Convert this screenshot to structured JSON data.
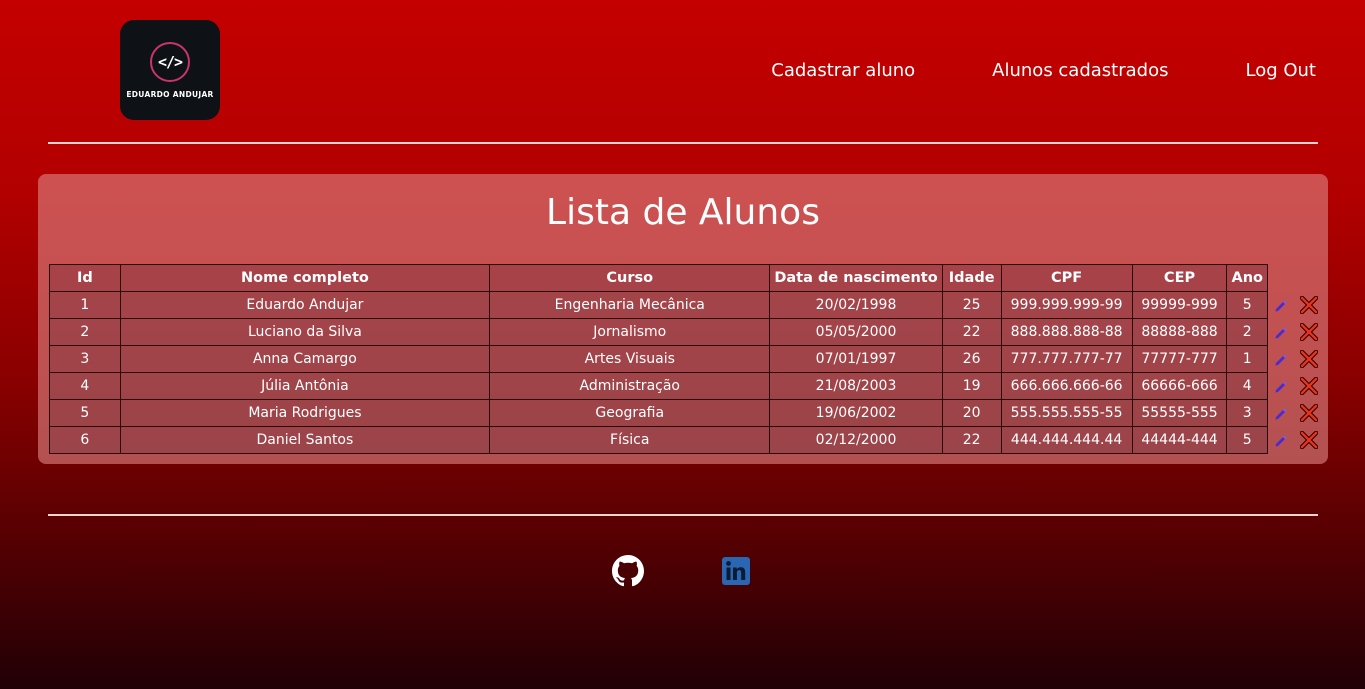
{
  "logo": {
    "symbol": "</>",
    "text": "EDUARDO ANDUJAR"
  },
  "nav": {
    "items": [
      {
        "label": "Cadastrar aluno"
      },
      {
        "label": "Alunos cadastrados"
      },
      {
        "label": "Log Out"
      }
    ]
  },
  "main": {
    "title": "Lista de Alunos",
    "headers": {
      "id": "Id",
      "nome": "Nome completo",
      "curso": "Curso",
      "nascimento": "Data de nascimento",
      "idade": "Idade",
      "cpf": "CPF",
      "cep": "CEP",
      "ano": "Ano"
    },
    "rows": [
      {
        "id": "1",
        "nome": "Eduardo Andujar",
        "curso": "Engenharia Mecânica",
        "nascimento": "20/02/1998",
        "idade": "25",
        "cpf": "999.999.999-99",
        "cep": "99999-999",
        "ano": "5"
      },
      {
        "id": "2",
        "nome": "Luciano da Silva",
        "curso": "Jornalismo",
        "nascimento": "05/05/2000",
        "idade": "22",
        "cpf": "888.888.888-88",
        "cep": "88888-888",
        "ano": "2"
      },
      {
        "id": "3",
        "nome": "Anna Camargo",
        "curso": "Artes Visuais",
        "nascimento": "07/01/1997",
        "idade": "26",
        "cpf": "777.777.777-77",
        "cep": "77777-777",
        "ano": "1"
      },
      {
        "id": "4",
        "nome": "Júlia Antônia",
        "curso": "Administração",
        "nascimento": "21/08/2003",
        "idade": "19",
        "cpf": "666.666.666-66",
        "cep": "66666-666",
        "ano": "4"
      },
      {
        "id": "5",
        "nome": "Maria Rodrigues",
        "curso": "Geografia",
        "nascimento": "19/06/2002",
        "idade": "20",
        "cpf": "555.555.555-55",
        "cep": "55555-555",
        "ano": "3"
      },
      {
        "id": "6",
        "nome": "Daniel Santos",
        "curso": "Física",
        "nascimento": "02/12/2000",
        "idade": "22",
        "cpf": "444.444.444.44",
        "cep": "44444-444",
        "ano": "5"
      }
    ],
    "row_actions": [
      "pencil-icon",
      "delete-x-icon"
    ]
  },
  "footer": {
    "icons": [
      "github-icon",
      "linkedin-icon"
    ]
  },
  "colors": {
    "accent_red": "#c40000",
    "linkedin_blue": "#2a67b2",
    "delete_red": "#e8321c"
  }
}
